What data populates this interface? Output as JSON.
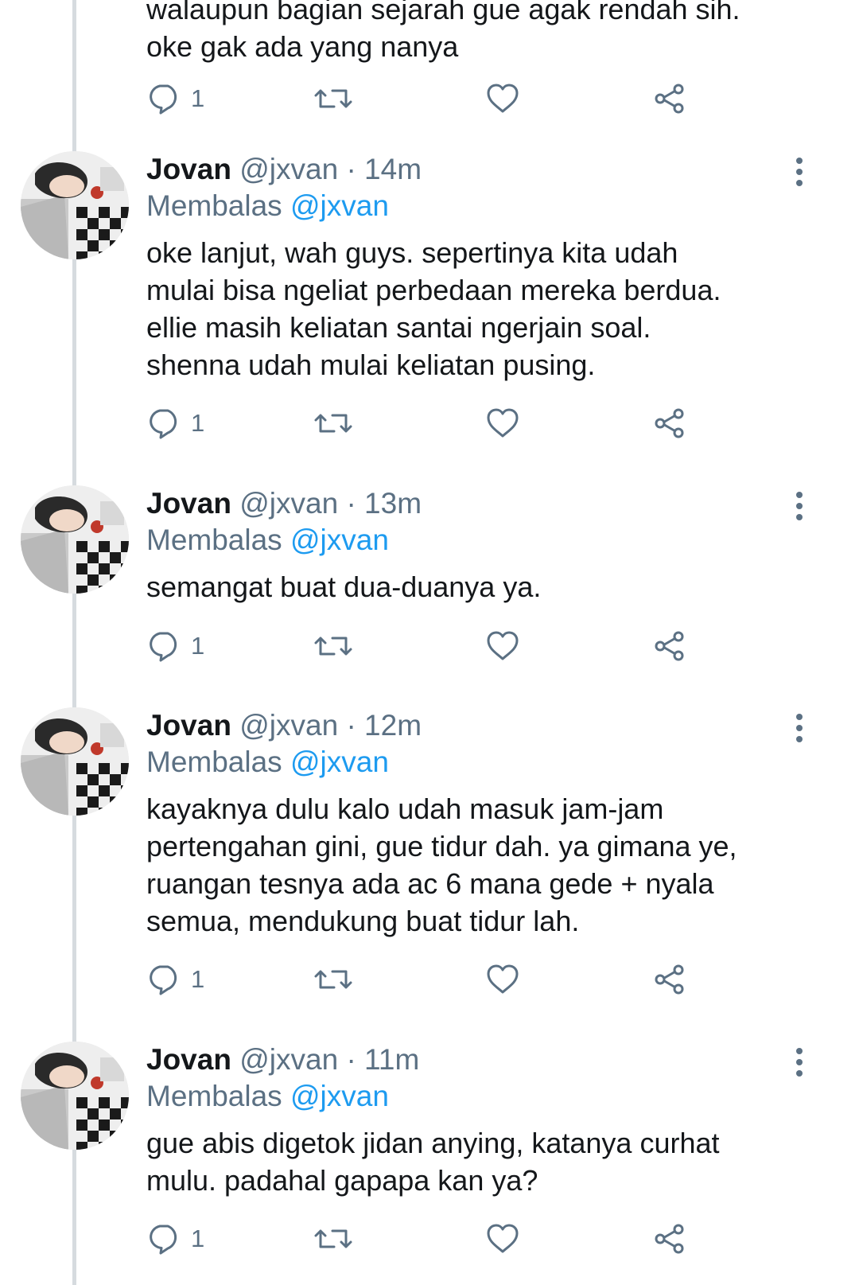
{
  "top_tweet": {
    "text_lines": [
      "walaupun bagian sejarah gue agak rendah sih.",
      "oke gak ada yang nanya"
    ],
    "reply_count": "1"
  },
  "tweets": [
    {
      "name": "Jovan",
      "handle": "@jxvan",
      "separator": "·",
      "time": "14m",
      "reply_prefix": "Membalas",
      "reply_mention": "@jxvan",
      "text_lines": [
        "oke lanjut, wah guys. sepertinya kita udah",
        "mulai bisa ngeliat perbedaan mereka berdua.",
        "ellie masih keliatan santai ngerjain soal.",
        "shenna udah mulai keliatan pusing."
      ],
      "reply_count": "1"
    },
    {
      "name": "Jovan",
      "handle": "@jxvan",
      "separator": "·",
      "time": "13m",
      "reply_prefix": "Membalas",
      "reply_mention": "@jxvan",
      "text_lines": [
        "semangat buat dua-duanya ya."
      ],
      "reply_count": "1"
    },
    {
      "name": "Jovan",
      "handle": "@jxvan",
      "separator": "·",
      "time": "12m",
      "reply_prefix": "Membalas",
      "reply_mention": "@jxvan",
      "text_lines": [
        "kayaknya dulu kalo udah masuk jam-jam",
        "pertengahan gini, gue tidur dah. ya gimana ye,",
        "ruangan tesnya ada ac 6 mana gede + nyala",
        "semua, mendukung buat tidur lah."
      ],
      "reply_count": "1"
    },
    {
      "name": "Jovan",
      "handle": "@jxvan",
      "separator": "·",
      "time": "11m",
      "reply_prefix": "Membalas",
      "reply_mention": "@jxvan",
      "text_lines": [
        "gue abis digetok jidan anying, katanya curhat",
        "mulu. padahal gapapa kan ya?"
      ],
      "reply_count": "1"
    }
  ],
  "icons": {
    "reply": "reply-bubble-icon",
    "retweet": "retweet-icon",
    "like": "heart-icon",
    "share": "share-icon",
    "more": "more-vertical-icon"
  },
  "colors": {
    "text": "#14171a",
    "secondary": "#5b7083",
    "mention": "#1d9bf0",
    "thread_line": "#d6dbdf"
  }
}
